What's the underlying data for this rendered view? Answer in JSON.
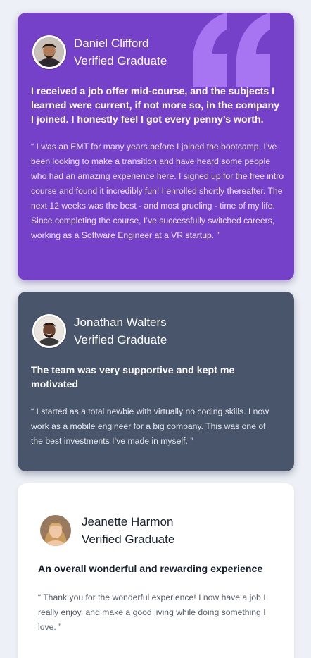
{
  "testimonials": [
    {
      "name": "Daniel Clifford",
      "role": "Verified Graduate",
      "headline": "I received a job offer mid-course, and the subjects I learned were current, if not more so, in the company I joined. I honestly feel I got every penny’s worth.",
      "body": "“ I was an EMT for many years before I joined the bootcamp. I’ve been looking to make a transition and have heard some people who had an amazing experience here. I signed up for the free intro course and found it incredibly fun! I enrolled shortly thereafter. The next 12 weeks was the best - and most grueling - time of my life. Since completing the course, I’ve successfully switched careers, working as a Software Engineer at a VR startup. ”",
      "color": "#7541c8"
    },
    {
      "name": "Jonathan Walters",
      "role": "Verified Graduate",
      "headline": "The team was very supportive and kept me motivated",
      "body": "“ I started as a total newbie with virtually no coding skills. I now work as a mobile engineer for a big company. This was one of the best investments I’ve made in myself. ”",
      "color": "#48556a"
    },
    {
      "name": "Jeanette Harmon",
      "role": "Verified Graduate",
      "headline": "An overall wonderful and rewarding experience",
      "body": "“ Thank you for the wonderful experience! I now have a job I really enjoy, and make a good living while doing something I love. ”",
      "color": "#ffffff"
    }
  ],
  "colors": {
    "page_background": "#edf0f6",
    "quote_icon": "#a775f1"
  },
  "icons": {
    "decorative_quote": "quote-icon"
  }
}
